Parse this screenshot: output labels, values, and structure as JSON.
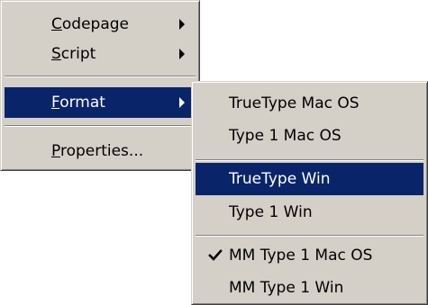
{
  "main_menu": {
    "items": [
      {
        "mnemonic": "C",
        "rest": "odepage",
        "has_submenu": true
      },
      {
        "mnemonic": "S",
        "rest": "cript",
        "has_submenu": true
      },
      {
        "mnemonic": "F",
        "rest": "ormat",
        "has_submenu": true,
        "selected": true
      },
      {
        "mnemonic": "P",
        "rest": "roperties...",
        "has_submenu": false
      }
    ]
  },
  "format_submenu": {
    "items": [
      {
        "label": "TrueType Mac OS"
      },
      {
        "label": "Type 1 Mac OS"
      },
      {
        "label": "TrueType Win",
        "selected": true
      },
      {
        "label": "Type 1 Win"
      },
      {
        "label": "MM Type 1 Mac OS",
        "checked": true
      },
      {
        "label": "MM Type 1 Win"
      }
    ]
  },
  "colors": {
    "menu_face": "#d4d0c8",
    "highlight": "#0a246a",
    "highlight_text": "#ffffff"
  },
  "icons": {
    "submenu_arrow": "submenu-arrow-icon",
    "checkmark": "checkmark-icon"
  }
}
